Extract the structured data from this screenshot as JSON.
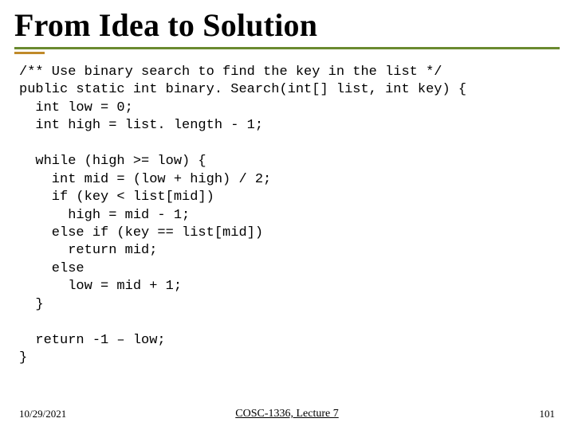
{
  "title": "From Idea to Solution",
  "code": "/** Use binary search to find the key in the list */\npublic static int binary. Search(int[] list, int key) {\n  int low = 0;\n  int high = list. length - 1;\n\n  while (high >= low) {\n    int mid = (low + high) / 2;\n    if (key < list[mid])\n      high = mid - 1;\n    else if (key == list[mid])\n      return mid;\n    else\n      low = mid + 1;\n  }\n\n  return -1 – low;\n}",
  "footer": {
    "date": "10/29/2021",
    "center": "COSC-1336, Lecture 7",
    "page": "101"
  }
}
